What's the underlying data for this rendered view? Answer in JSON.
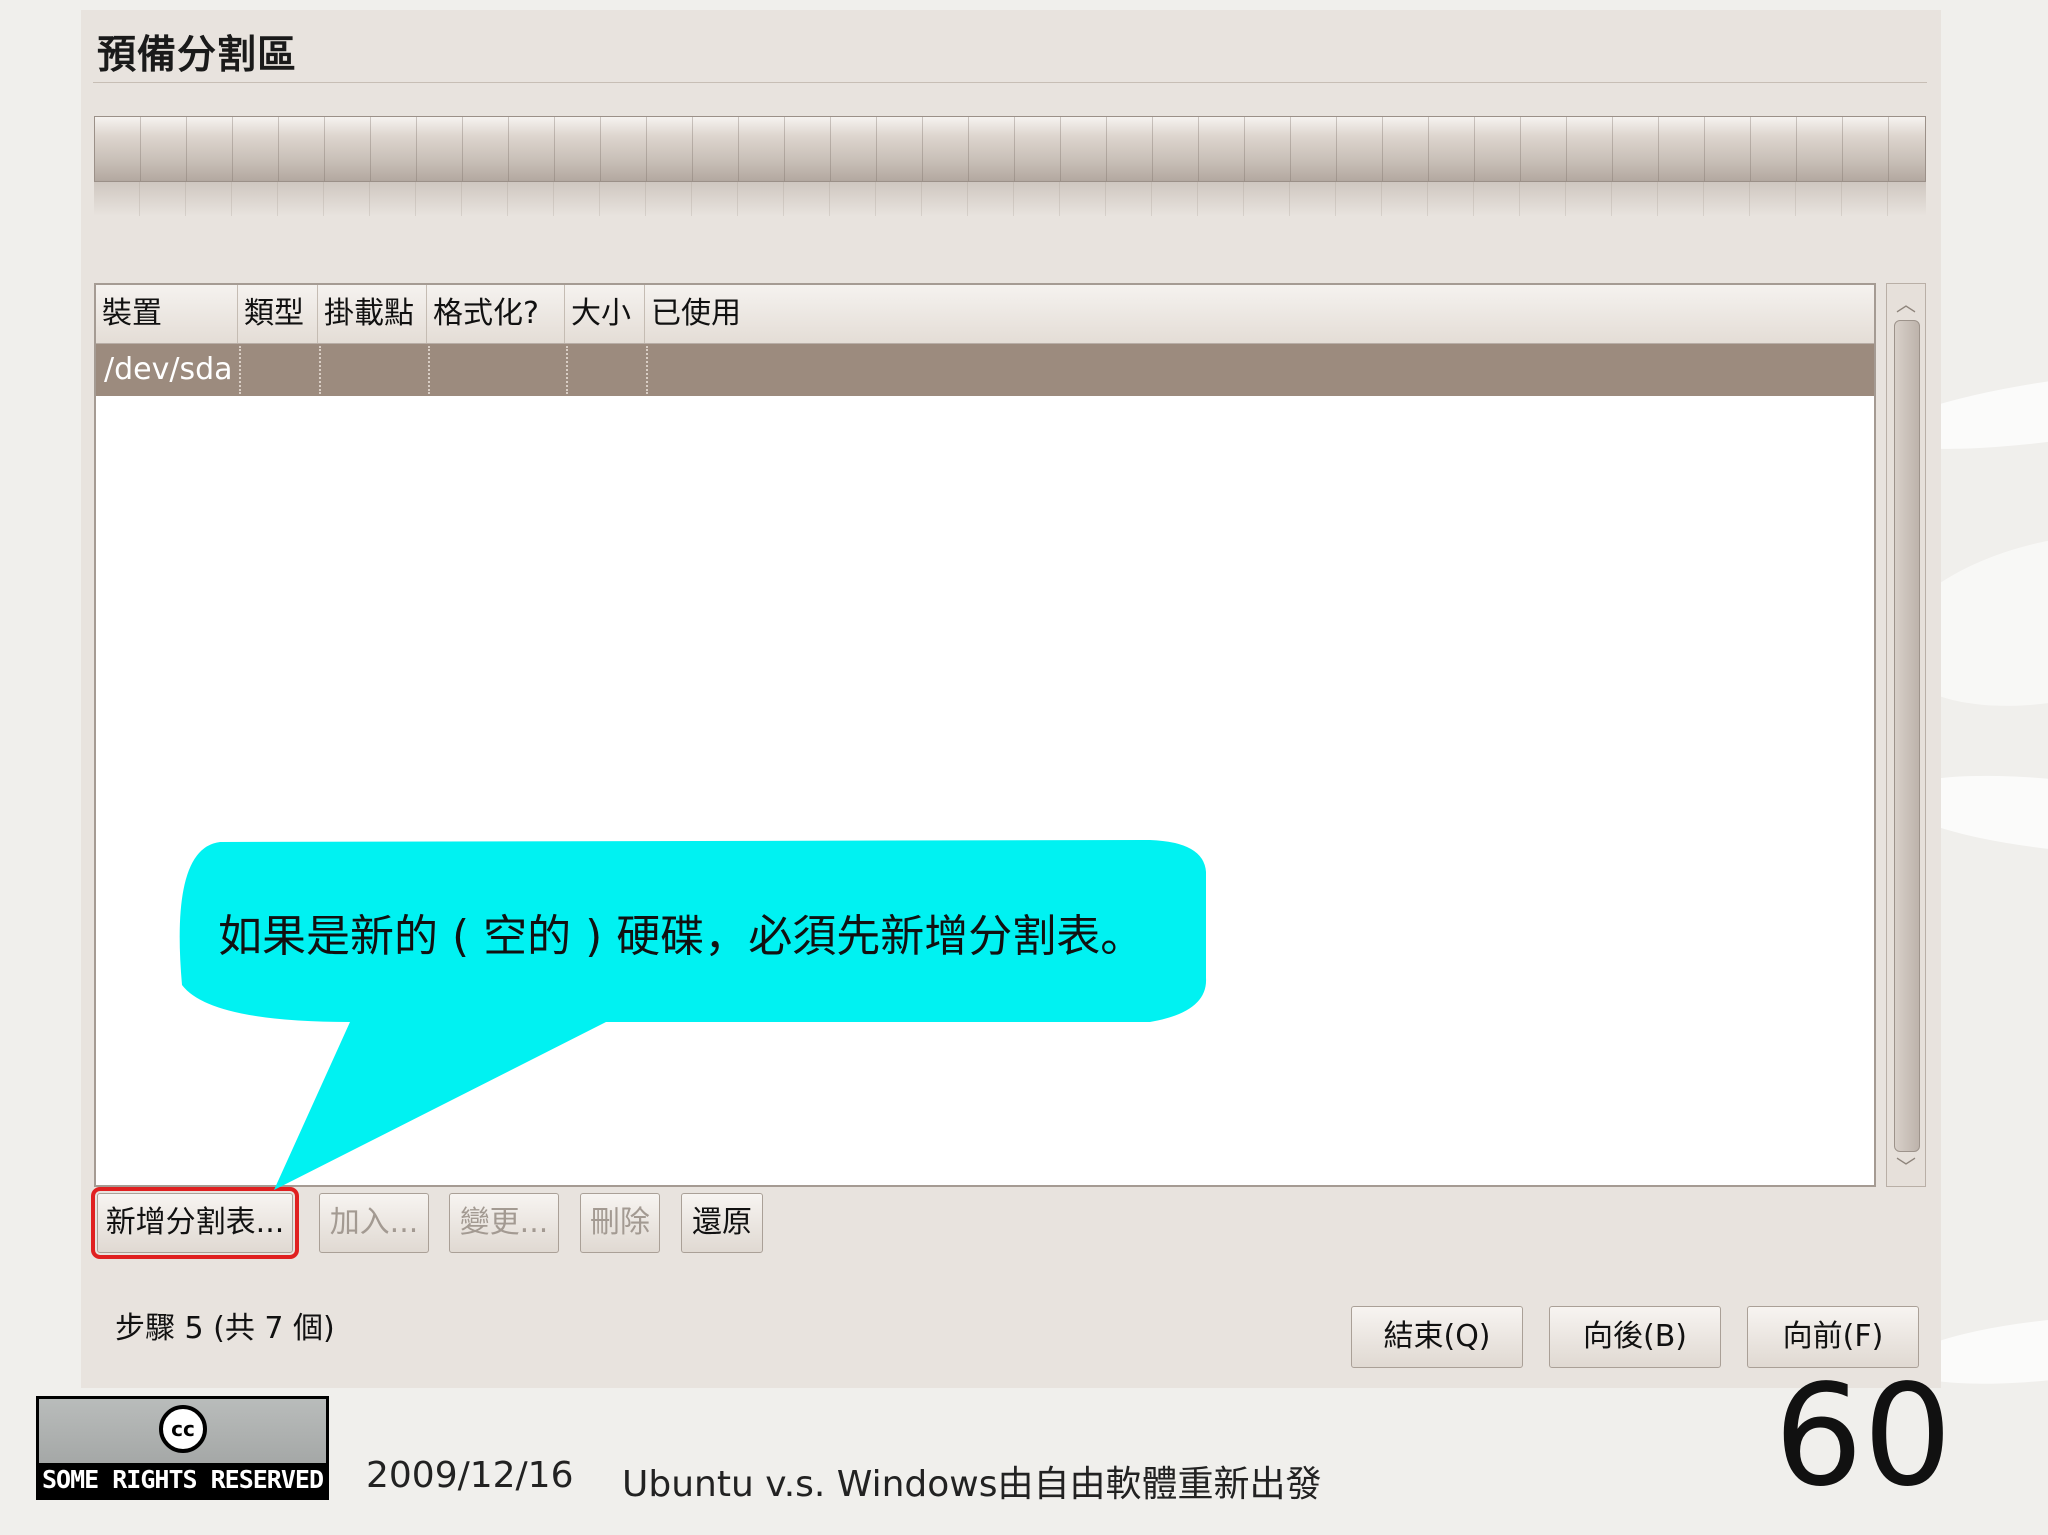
{
  "window": {
    "title": "預備分割區"
  },
  "table": {
    "columns": [
      "裝置",
      "類型",
      "掛載點",
      "格式化?",
      "大小",
      "已使用"
    ],
    "rows": [
      {
        "device": "/dev/sda"
      }
    ]
  },
  "buttons": {
    "new_partition_table": "新增分割表...",
    "add": "加入...",
    "change": "變更...",
    "delete": "刪除",
    "revert": "還原"
  },
  "footer_nav": {
    "step": "步驟 5 (共 7 個)",
    "quit": "結束(Q)",
    "back": "向後(B)",
    "forward": "向前(F)"
  },
  "callout": {
    "text": "如果是新的 ( 空的 ) 硬碟，必須先新增分割表。",
    "color": "#00f2f2"
  },
  "highlight_color": "#e02020",
  "slide": {
    "license_badge": "SOME RIGHTS RESERVED",
    "license_symbol": "cc",
    "date": "2009/12/16",
    "title": "Ubuntu v.s. Windows由自由軟體重新出發",
    "page_number": "60"
  }
}
